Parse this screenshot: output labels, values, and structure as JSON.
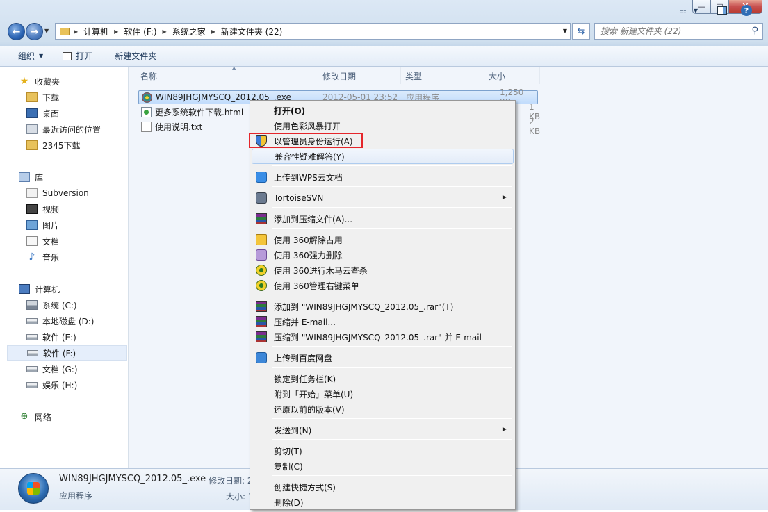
{
  "window": {
    "controls": {
      "minimize": "—",
      "maximize": "□",
      "close": "✕"
    }
  },
  "address": {
    "crumbs": [
      "计算机",
      "软件 (F:)",
      "系统之家",
      "新建文件夹 (22)"
    ],
    "search_placeholder": "搜索 新建文件夹 (22)"
  },
  "toolbar": {
    "organize": "组织",
    "open": "打开",
    "new_folder": "新建文件夹"
  },
  "sidebar": {
    "favorites": {
      "label": "收藏夹",
      "items": [
        "下载",
        "桌面",
        "最近访问的位置",
        "2345下载"
      ]
    },
    "libraries": {
      "label": "库",
      "items": [
        "Subversion",
        "视频",
        "图片",
        "文档",
        "音乐"
      ]
    },
    "computer": {
      "label": "计算机",
      "items": [
        "系统 (C:)",
        "本地磁盘 (D:)",
        "软件 (E:)",
        "软件 (F:)",
        "文档 (G:)",
        "娱乐 (H:)"
      ]
    },
    "network": {
      "label": "网络"
    },
    "selected_item": "软件 (F:)"
  },
  "columns": {
    "name": "名称",
    "modified": "修改日期",
    "type": "类型",
    "size": "大小"
  },
  "files": [
    {
      "name": "WIN89JHGJMYSCQ_2012.05_.exe",
      "modified": "2012-05-01 23:52",
      "type": "应用程序",
      "size": "1,250 KB"
    },
    {
      "name": "更多系统软件下载.html",
      "modified": "",
      "type": "",
      "size": "1 KB"
    },
    {
      "name": "使用说明.txt",
      "modified": "",
      "type": "",
      "size": "2 KB"
    }
  ],
  "context_menu": {
    "items": [
      "打开(O)",
      "使用色彩风暴打开",
      "以管理员身份运行(A)",
      "兼容性疑难解答(Y)",
      "上传到WPS云文档",
      "TortoiseSVN",
      "添加到压缩文件(A)...",
      "使用 360解除占用",
      "使用 360强力删除",
      "使用 360进行木马云查杀",
      "使用 360管理右键菜单",
      "添加到 \"WIN89JHGJMYSCQ_2012.05_.rar\"(T)",
      "压缩并 E-mail...",
      "压缩到 \"WIN89JHGJMYSCQ_2012.05_.rar\" 并 E-mail",
      "上传到百度网盘",
      "锁定到任务栏(K)",
      "附到「开始」菜单(U)",
      "还原以前的版本(V)",
      "发送到(N)",
      "剪切(T)",
      "复制(C)",
      "创建快捷方式(S)",
      "删除(D)"
    ],
    "highlighted": "兼容性疑难解答(Y)",
    "annotated": "以管理员身份运行(A)"
  },
  "details": {
    "name": "WIN89JHGJMYSCQ_2012.05_.exe",
    "type": "应用程序",
    "modified_label": "修改日期:",
    "modified_value": "2",
    "size_label": "大小:",
    "size_value": "1"
  },
  "colors": {
    "selection_red_box": "#e5262b",
    "accent_blue": "#2d62a8"
  }
}
